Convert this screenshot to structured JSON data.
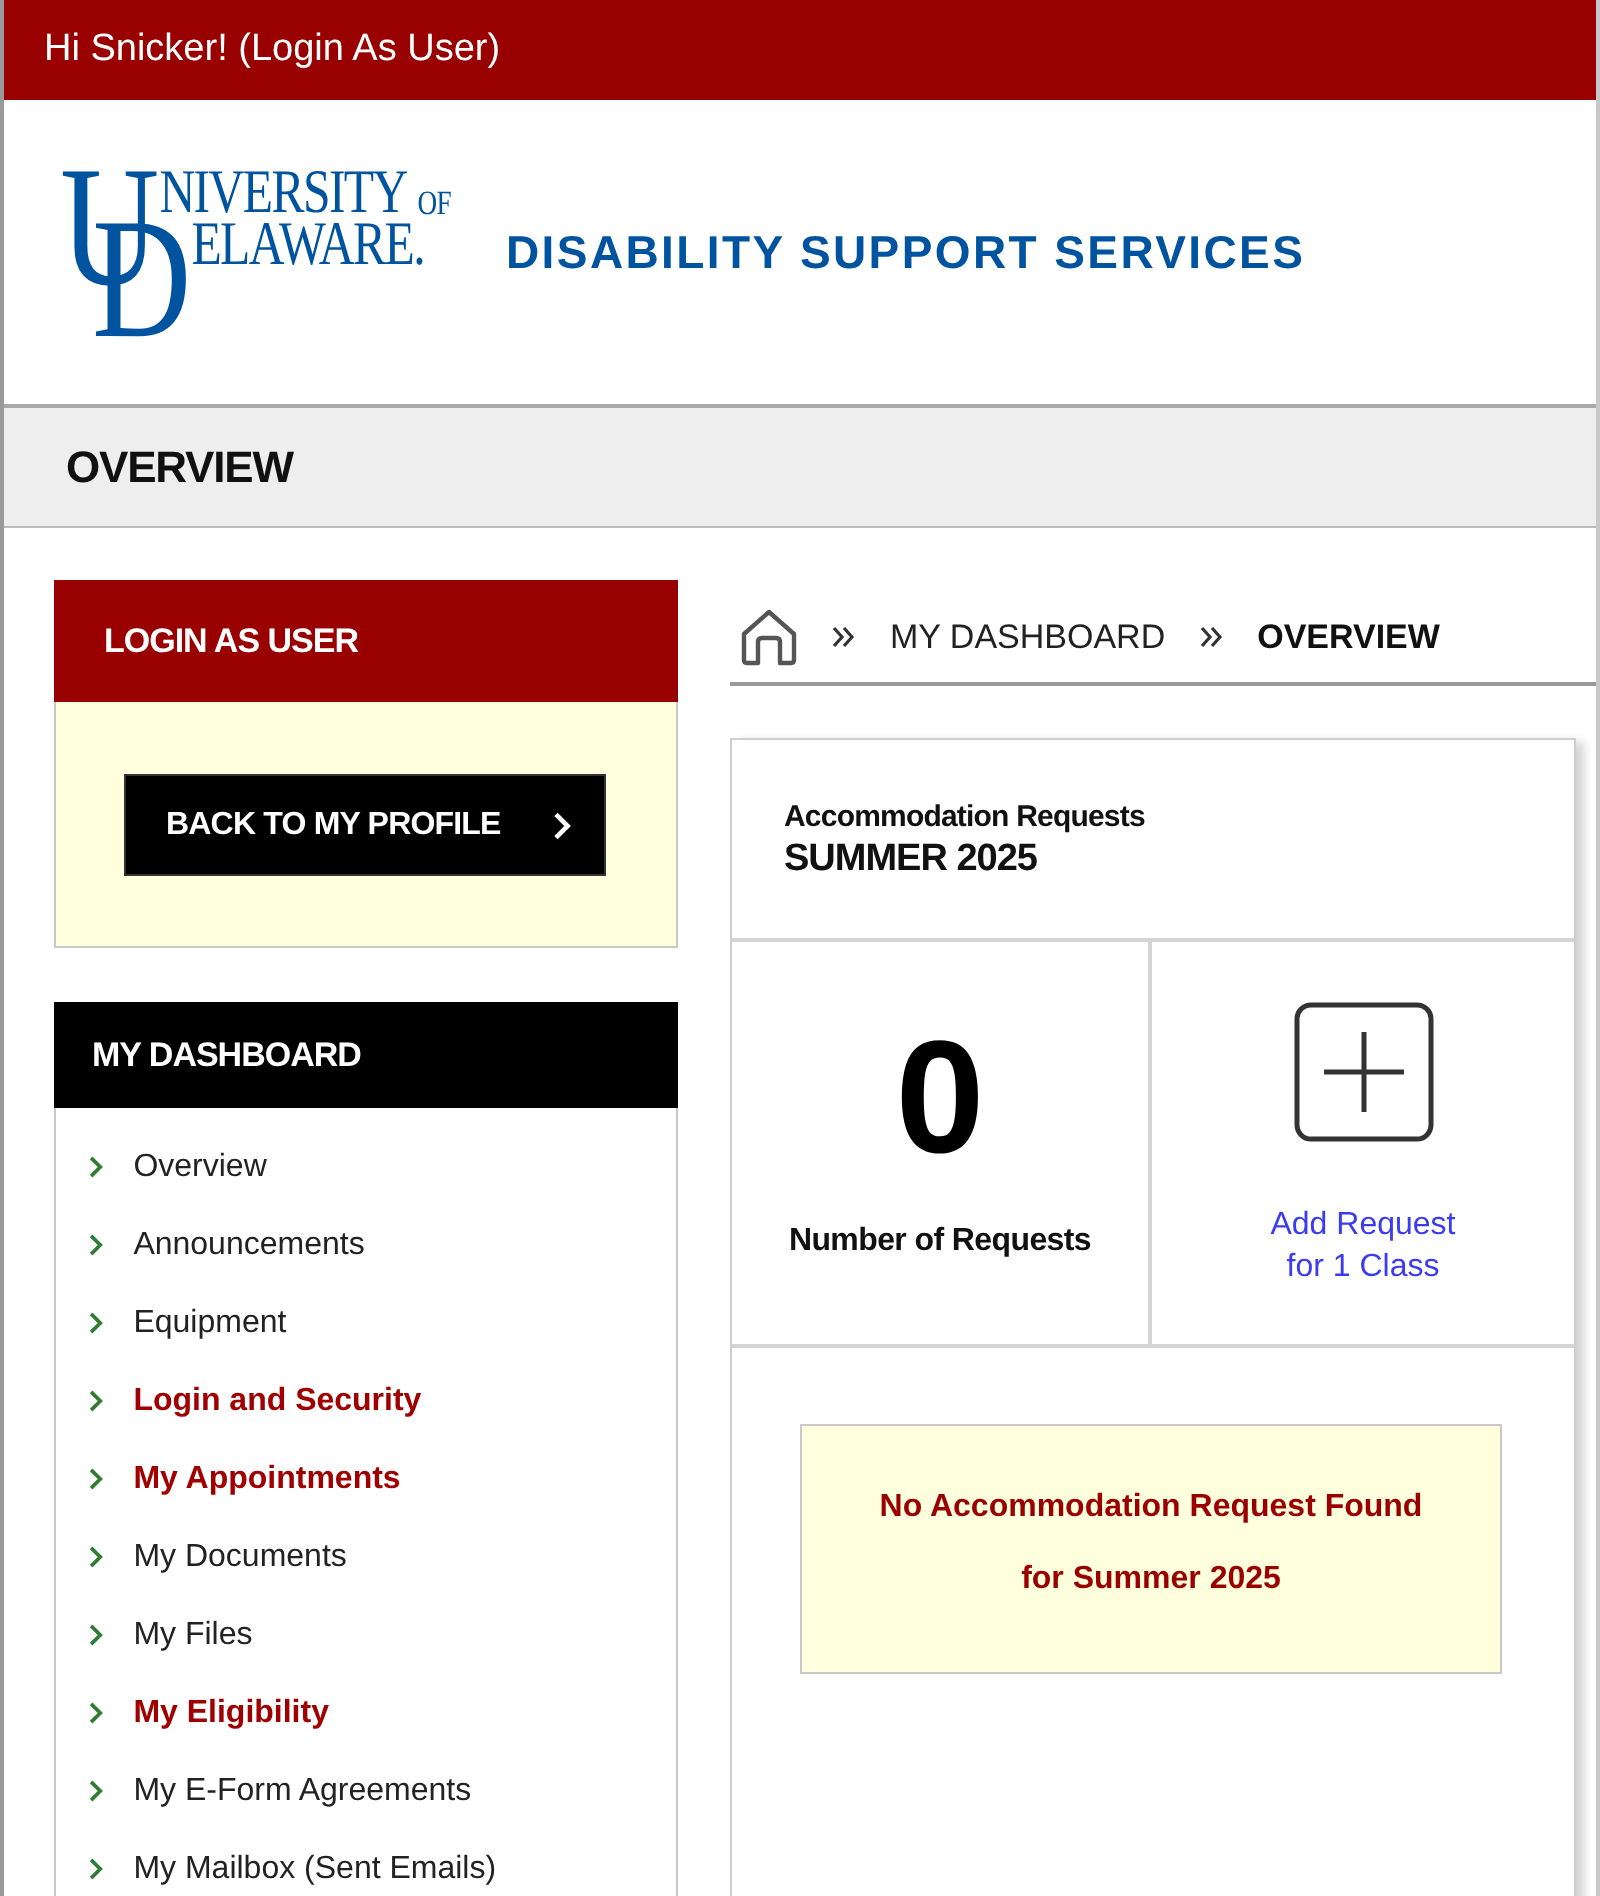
{
  "top_bar": {
    "greeting": "Hi Snicker! (Login As User)"
  },
  "header": {
    "logo": {
      "line_1": "UNIVERSITY",
      "of": "OF",
      "line_2": "DELAWARE."
    },
    "title": "DISABILITY SUPPORT SERVICES"
  },
  "page_title": "OVERVIEW",
  "login_as_user_panel": {
    "title": "LOGIN AS USER",
    "button": "BACK TO MY PROFILE"
  },
  "dashboard_menu": {
    "title": "MY DASHBOARD",
    "items": [
      {
        "label": "Overview",
        "alert": false
      },
      {
        "label": "Announcements",
        "alert": false
      },
      {
        "label": "Equipment",
        "alert": false
      },
      {
        "label": "Login and Security",
        "alert": true
      },
      {
        "label": "My Appointments",
        "alert": true
      },
      {
        "label": "My Documents",
        "alert": false
      },
      {
        "label": "My Files",
        "alert": false
      },
      {
        "label": "My Eligibility",
        "alert": true
      },
      {
        "label": "My E-Form Agreements",
        "alert": false
      },
      {
        "label": "My Mailbox (Sent Emails)",
        "alert": false
      }
    ]
  },
  "breadcrumb": [
    {
      "kind": "home"
    },
    {
      "kind": "link",
      "label": "MY DASHBOARD"
    },
    {
      "kind": "current",
      "label": "OVERVIEW"
    }
  ],
  "requests_card": {
    "title": "Accommodation Requests",
    "term": "SUMMER 2025",
    "count": "0",
    "count_label": "Number of Requests",
    "add_link": "Add Request for 1 Class",
    "notice": "No Accommodation Request Found for Summer 2025"
  }
}
